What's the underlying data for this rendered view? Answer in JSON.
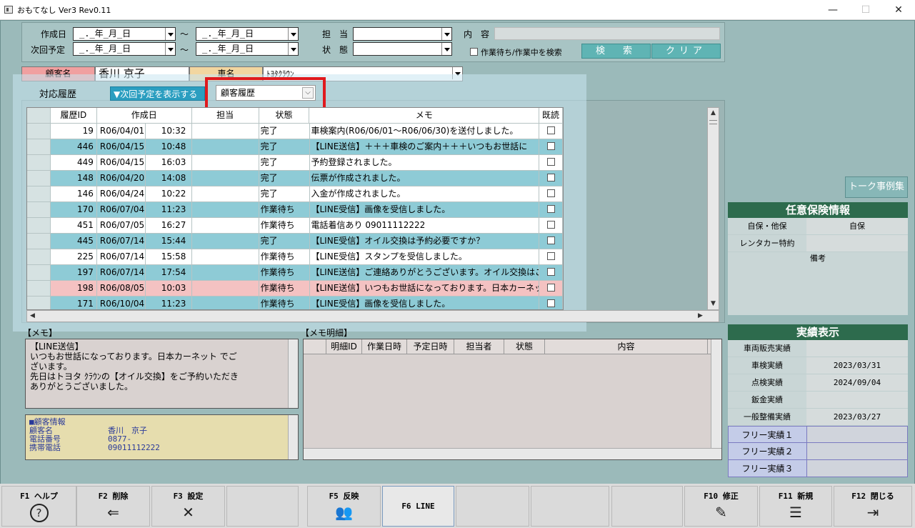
{
  "window": {
    "title": "おもてなし Ver3 Rev0.11",
    "minimize": "—",
    "maximize": "☐",
    "close": "✕"
  },
  "criteria": {
    "created_label": "作成日",
    "next_label": "次回予定",
    "date_placeholder": "_._年_月_日",
    "tilde": "～",
    "staff_label": "担　当",
    "status_label": "状　態",
    "content_label": "内　容",
    "checkbox_label": "作業待ち/作業中を検索",
    "search_btn": "検　索",
    "clear_btn": "クリア"
  },
  "customer": {
    "name_label": "顧客名",
    "name_value": "香川 京子",
    "car_label": "車名",
    "car_value": "ﾄﾖﾀｸﾗｳﾝ"
  },
  "history": {
    "label": "対応履歴",
    "toggle": "▼次回予定を表示する",
    "select_value": "顧客履歴",
    "headers": [
      "履歴ID",
      "作成日",
      "担当",
      "状態",
      "メモ",
      "既読"
    ],
    "rows": [
      {
        "id": "19",
        "date": "R06/04/01",
        "time": "10:32",
        "staff": "",
        "status": "完了",
        "memo": "車検案内(R06/06/01～R06/06/30)を送付しました。",
        "tone": "white"
      },
      {
        "id": "446",
        "date": "R06/04/15",
        "time": "10:48",
        "staff": "",
        "status": "完了",
        "memo": "【LINE送信】＋＋＋車検のご案内＋＋＋いつもお世話に",
        "tone": "blue"
      },
      {
        "id": "449",
        "date": "R06/04/15",
        "time": "16:03",
        "staff": "",
        "status": "完了",
        "memo": "予約登録されました。",
        "tone": "white"
      },
      {
        "id": "148",
        "date": "R06/04/20",
        "time": "14:08",
        "staff": "",
        "status": "完了",
        "memo": "伝票が作成されました。",
        "tone": "blue"
      },
      {
        "id": "146",
        "date": "R06/04/24",
        "time": "10:22",
        "staff": "",
        "status": "完了",
        "memo": "入金が作成されました。",
        "tone": "white"
      },
      {
        "id": "170",
        "date": "R06/07/04",
        "time": "11:23",
        "staff": "",
        "status": "作業待ち",
        "memo": "【LINE受信】画像を受信しました。",
        "tone": "blue"
      },
      {
        "id": "451",
        "date": "R06/07/05",
        "time": "16:27",
        "staff": "",
        "status": "作業待ち",
        "memo": "電話着信あり 09011112222",
        "tone": "white"
      },
      {
        "id": "445",
        "date": "R06/07/14",
        "time": "15:44",
        "staff": "",
        "status": "完了",
        "memo": "【LINE受信】オイル交換は予約必要ですか？",
        "tone": "blue"
      },
      {
        "id": "225",
        "date": "R06/07/14",
        "time": "15:58",
        "staff": "",
        "status": "作業待ち",
        "memo": "【LINE受信】スタンプを受信しました。",
        "tone": "white"
      },
      {
        "id": "197",
        "date": "R06/07/14",
        "time": "17:54",
        "staff": "",
        "status": "作業待ち",
        "memo": "【LINE送信】ご連絡ありがとうございます。オイル交換はご",
        "tone": "blue"
      },
      {
        "id": "198",
        "date": "R06/08/05",
        "time": "10:03",
        "staff": "",
        "status": "作業待ち",
        "memo": "【LINE送信】いつもお世話になっております。日本カーネッ",
        "tone": "pink"
      },
      {
        "id": "171",
        "date": "R06/10/04",
        "time": "11:23",
        "staff": "",
        "status": "作業待ち",
        "memo": "【LINE受信】画像を受信しました。",
        "tone": "blue"
      }
    ]
  },
  "memo": {
    "label": "【メモ】",
    "lines": [
      "【LINE送信】",
      "いつもお世話になっております。日本カーネット でご",
      "ざいます。",
      "先日はトヨタ ｸﾗｳﾝの【オイル交換】をご予約いただき",
      "ありがとうございました。"
    ]
  },
  "cust_info": {
    "title": "■顧客情報",
    "rows": [
      {
        "k": "顧客名",
        "v": "香川　京子"
      },
      {
        "k": "電話番号",
        "v": "0877-"
      },
      {
        "k": "携帯電話",
        "v": "09011112222"
      }
    ]
  },
  "detail": {
    "label": "【メモ明細】",
    "headers": [
      "明細ID",
      "作業日時",
      "予定日時",
      "担当者",
      "状態",
      "内容"
    ]
  },
  "talk_btn": "トーク事例集",
  "insurance": {
    "title": "任意保険情報",
    "rows": [
      {
        "k": "自保・他保",
        "v": "自保"
      },
      {
        "k": "レンタカー特約",
        "v": ""
      }
    ],
    "note_label": "備考"
  },
  "results": {
    "title": "実績表示",
    "rows": [
      {
        "k": "車両販売実績",
        "v": ""
      },
      {
        "k": "車検実績",
        "v": "2023/03/31"
      },
      {
        "k": "点検実績",
        "v": "2024/09/04"
      },
      {
        "k": "鈑金実績",
        "v": ""
      },
      {
        "k": "一般整備実績",
        "v": "2023/03/27"
      }
    ],
    "free": [
      "フリー実績１",
      "フリー実績２",
      "フリー実績３"
    ]
  },
  "fkeys": [
    {
      "label": "F1 ヘルプ",
      "icon": "?"
    },
    {
      "label": "F2 削除",
      "icon": "⇐"
    },
    {
      "label": "F3 設定",
      "icon": "✕"
    },
    {
      "label": "",
      "icon": ""
    },
    {
      "label": "F5 反映",
      "icon": "👥"
    },
    {
      "label": "F6 LINE",
      "icon": ""
    },
    {
      "label": "",
      "icon": ""
    },
    {
      "label": "",
      "icon": ""
    },
    {
      "label": "",
      "icon": ""
    },
    {
      "label": "F10 修正",
      "icon": "✎"
    },
    {
      "label": "F11 新規",
      "icon": "☰"
    },
    {
      "label": "F12 閉じる",
      "icon": "⇥"
    }
  ]
}
